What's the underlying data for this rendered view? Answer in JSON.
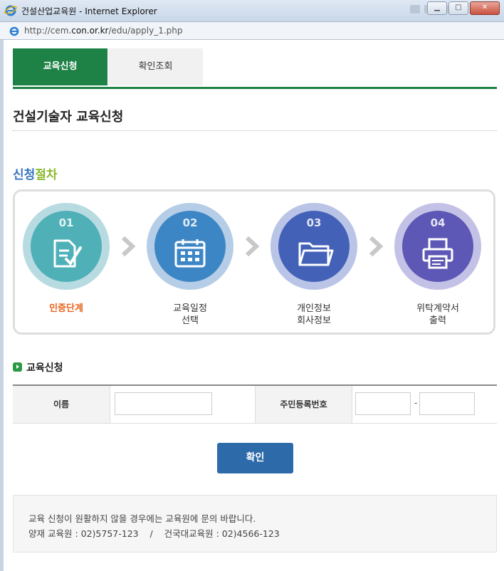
{
  "window": {
    "title": "건설산업교육원 - Internet Explorer",
    "url_prefix": "http://cem.",
    "url_domain": "con.or.kr",
    "url_suffix": "/edu/apply_1.php"
  },
  "tabs": [
    {
      "label": "교육신청",
      "active": true
    },
    {
      "label": "확인조회",
      "active": false
    }
  ],
  "page_title": "건설기술자 교육신청",
  "procedure": {
    "heading_part1": "신청",
    "heading_part2": "절차",
    "steps": [
      {
        "num": "01",
        "label_line1": "인증단계",
        "label_line2": "",
        "icon": "document-check-icon",
        "outer": "#b7dbe0",
        "inner": "#4fb0b8",
        "active": true
      },
      {
        "num": "02",
        "label_line1": "교육일정",
        "label_line2": "선택",
        "icon": "calendar-icon",
        "outer": "#b5cde6",
        "inner": "#3d86c6",
        "active": false
      },
      {
        "num": "03",
        "label_line1": "개인정보",
        "label_line2": "회사정보",
        "icon": "folder-icon",
        "outer": "#b9c4e6",
        "inner": "#4461b8",
        "active": false
      },
      {
        "num": "04",
        "label_line1": "위탁계약서",
        "label_line2": "출력",
        "icon": "printer-icon",
        "outer": "#c4c1e6",
        "inner": "#5d57b5",
        "active": false
      }
    ]
  },
  "form": {
    "heading": "교육신청",
    "name_label": "이름",
    "name_value": "",
    "rrn_label": "주민등록번호",
    "rrn_first": "",
    "rrn_separator": "-",
    "rrn_second": ""
  },
  "confirm_button": "확인",
  "notice": {
    "line1": "교육 신청이 원활하지 않을 경우에는 교육원에 문의 바랍니다.",
    "line2": "양재 교육원 : 02)5757-123    /    건국대교육원 : 02)4566-123"
  },
  "colors": {
    "accent_green": "#1e8246",
    "button_blue": "#2d6aa9",
    "active_step": "#e8621b"
  }
}
